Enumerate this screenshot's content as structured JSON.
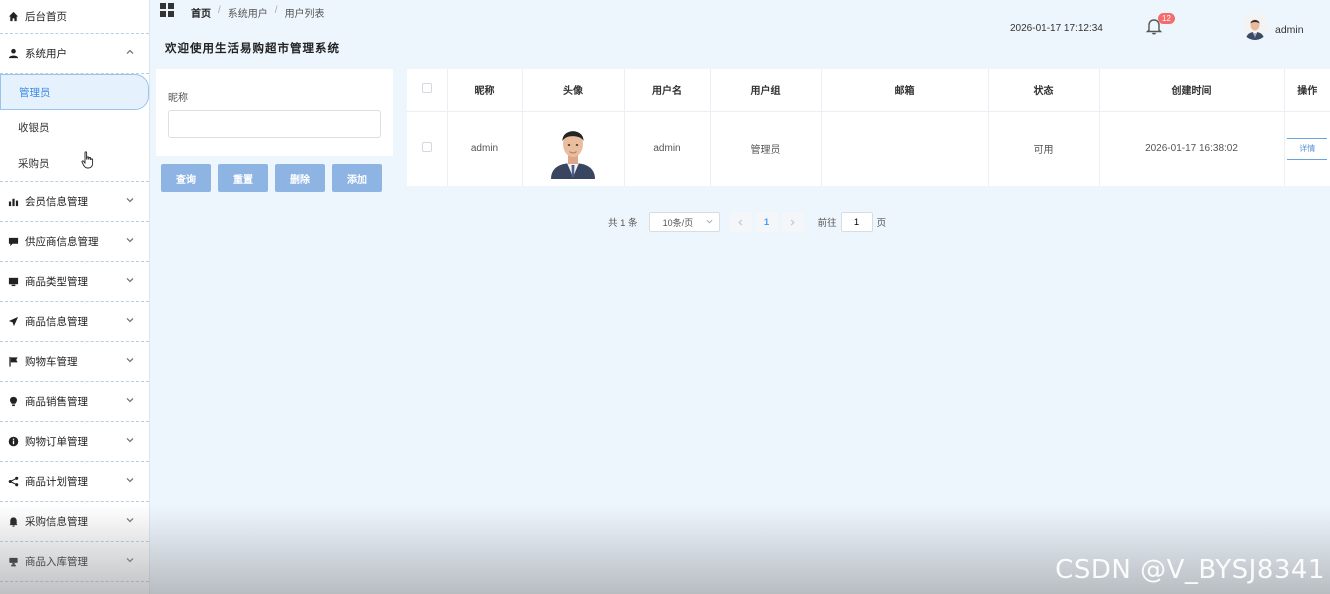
{
  "sidebar": {
    "home": "后台首页",
    "system_users": {
      "label": "系统用户",
      "children": [
        "管理员",
        "收银员",
        "采购员"
      ]
    },
    "menus": [
      {
        "label": "会员信息管理",
        "icon": "bar-chart-icon"
      },
      {
        "label": "供应商信息管理",
        "icon": "chat-icon"
      },
      {
        "label": "商品类型管理",
        "icon": "monitor-icon"
      },
      {
        "label": "商品信息管理",
        "icon": "send-icon"
      },
      {
        "label": "购物车管理",
        "icon": "flag-icon"
      },
      {
        "label": "商品销售管理",
        "icon": "bulb-icon"
      },
      {
        "label": "购物订单管理",
        "icon": "info-icon"
      },
      {
        "label": "商品计划管理",
        "icon": "share-icon"
      },
      {
        "label": "采购信息管理",
        "icon": "bell-icon"
      },
      {
        "label": "商品入库管理",
        "icon": "stamp-icon"
      }
    ]
  },
  "header": {
    "breadcrumb": [
      "首页",
      "系统用户",
      "用户列表"
    ],
    "title": "欢迎使用生活易购超市管理系统",
    "datetime": "2026-01-17 17:12:34",
    "notification_count": "12",
    "username": "admin"
  },
  "search": {
    "label": "昵称",
    "value": "",
    "placeholder": ""
  },
  "buttons": {
    "query": "查询",
    "reset": "重置",
    "delete": "删除",
    "add": "添加"
  },
  "table": {
    "headers": [
      "昵称",
      "头像",
      "用户名",
      "用户组",
      "邮箱",
      "状态",
      "创建时间",
      "操作"
    ],
    "rows": [
      {
        "nickname": "admin",
        "username": "admin",
        "group": "管理员",
        "email": "",
        "status": "可用",
        "created": "2026-01-17 16:38:02",
        "action": "详情"
      }
    ]
  },
  "pagination": {
    "total": "共 1 条",
    "page_size": "10条/页",
    "current": "1",
    "goto_label": "前往",
    "goto_value": "1",
    "page_unit": "页"
  },
  "watermark": "CSDN @V_BYSJ8341",
  "colors": {
    "accent": "#409eff",
    "button": "#8eb4e4",
    "badge": "#f56c6c",
    "background": "#eef6fd"
  }
}
